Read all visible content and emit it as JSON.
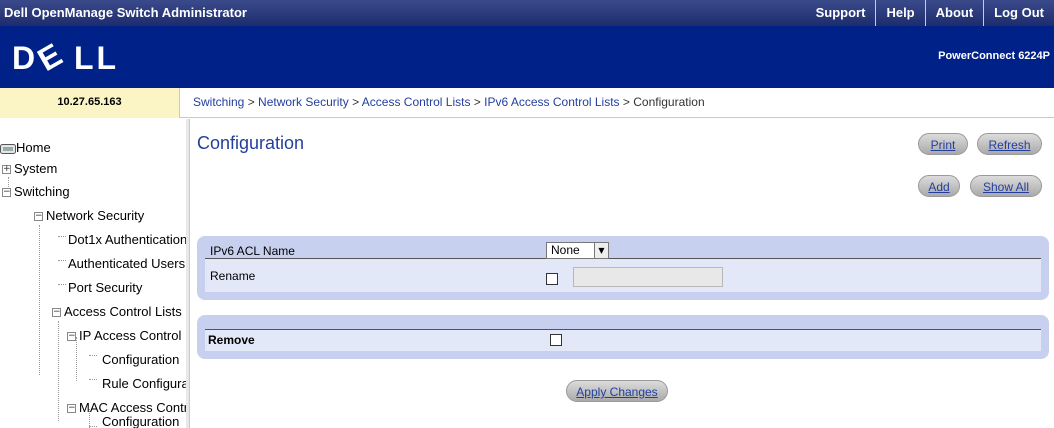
{
  "header": {
    "app_title": "Dell OpenManage Switch Administrator",
    "links": [
      "Support",
      "Help",
      "About",
      "Log Out"
    ],
    "logo_text": "DELL",
    "model": "PowerConnect 6224P"
  },
  "subheader": {
    "ip": "10.27.65.163",
    "breadcrumbs": [
      "Switching",
      "Network Security",
      "Access Control Lists",
      "IPv6 Access Control Lists"
    ],
    "separator": " > ",
    "current": "Configuration"
  },
  "sidebar": {
    "items": [
      {
        "label": "Home",
        "icon": "home-icon"
      },
      {
        "label": "System",
        "expander": "+"
      },
      {
        "label": "Switching",
        "expander": "−"
      },
      {
        "label": "Network Security",
        "expander": "−"
      },
      {
        "label": "Dot1x Authentication"
      },
      {
        "label": "Authenticated Users"
      },
      {
        "label": "Port Security"
      },
      {
        "label": "Access Control Lists",
        "expander": "−"
      },
      {
        "label": "IP Access Control Lists",
        "expander": "−"
      },
      {
        "label": "Configuration"
      },
      {
        "label": "Rule Configuration"
      },
      {
        "label": "MAC Access Control Lists",
        "expander": "−"
      },
      {
        "label": "Configuration"
      }
    ]
  },
  "main": {
    "title": "Configuration",
    "buttons": {
      "print": "Print",
      "refresh": "Refresh",
      "add": "Add",
      "show_all": "Show All",
      "apply": "Apply Changes"
    },
    "form": {
      "acl_name_label": "IPv6 ACL Name",
      "acl_name_value": "None",
      "rename_label": "Rename",
      "rename_checked": false,
      "rename_value": "",
      "remove_label": "Remove",
      "remove_checked": false
    }
  }
}
